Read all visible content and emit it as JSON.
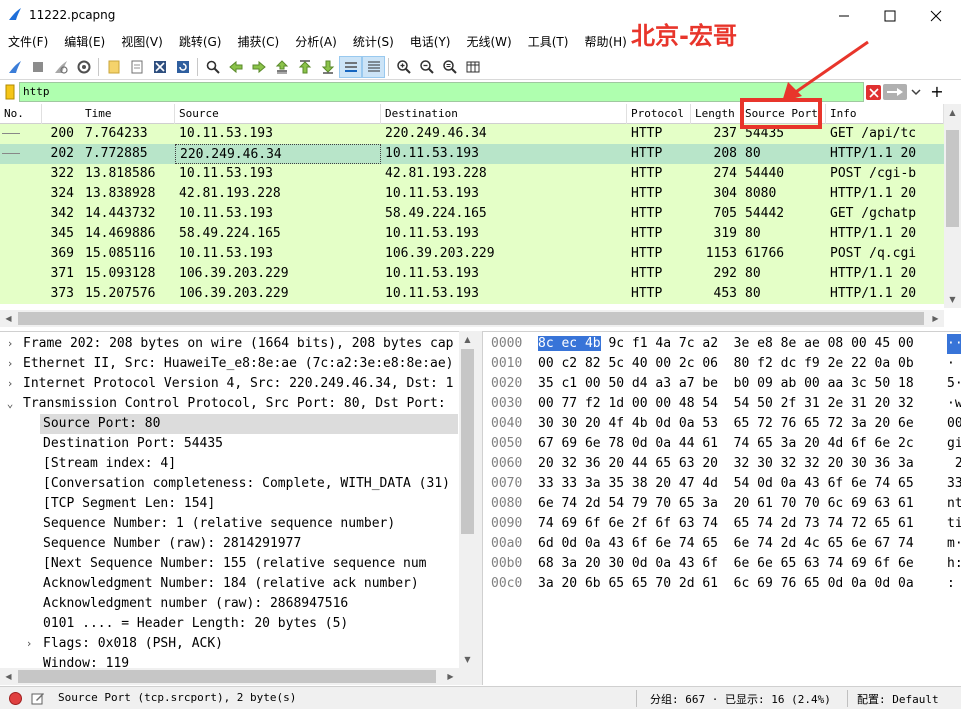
{
  "window": {
    "title": "11222.pcapng"
  },
  "annotation": {
    "text": "北京-宏哥"
  },
  "menu": [
    "文件(F)",
    "编辑(E)",
    "视图(V)",
    "跳转(G)",
    "捕获(C)",
    "分析(A)",
    "统计(S)",
    "电话(Y)",
    "无线(W)",
    "工具(T)",
    "帮助(H)"
  ],
  "filter": {
    "value": "http"
  },
  "packet_list": {
    "columns": [
      "No.",
      "Time",
      "Source",
      "Destination",
      "Protocol",
      "Length",
      "Source Port",
      "Info"
    ],
    "rows": [
      {
        "no": "200",
        "time": "7.764233",
        "src": "10.11.53.193",
        "dst": "220.249.46.34",
        "proto": "HTTP",
        "len": "237",
        "sport": "54435",
        "info": "GET /api/tc"
      },
      {
        "no": "202",
        "time": "7.772885",
        "src": "220.249.46.34",
        "dst": "10.11.53.193",
        "proto": "HTTP",
        "len": "208",
        "sport": "80",
        "info": "HTTP/1.1 20"
      },
      {
        "no": "322",
        "time": "13.818586",
        "src": "10.11.53.193",
        "dst": "42.81.193.228",
        "proto": "HTTP",
        "len": "274",
        "sport": "54440",
        "info": "POST /cgi-b"
      },
      {
        "no": "324",
        "time": "13.838928",
        "src": "42.81.193.228",
        "dst": "10.11.53.193",
        "proto": "HTTP",
        "len": "304",
        "sport": "8080",
        "info": "HTTP/1.1 20"
      },
      {
        "no": "342",
        "time": "14.443732",
        "src": "10.11.53.193",
        "dst": "58.49.224.165",
        "proto": "HTTP",
        "len": "705",
        "sport": "54442",
        "info": "GET /gchatp"
      },
      {
        "no": "345",
        "time": "14.469886",
        "src": "58.49.224.165",
        "dst": "10.11.53.193",
        "proto": "HTTP",
        "len": "319",
        "sport": "80",
        "info": "HTTP/1.1 20"
      },
      {
        "no": "369",
        "time": "15.085116",
        "src": "10.11.53.193",
        "dst": "106.39.203.229",
        "proto": "HTTP",
        "len": "1153",
        "sport": "61766",
        "info": "POST /q.cgi"
      },
      {
        "no": "371",
        "time": "15.093128",
        "src": "106.39.203.229",
        "dst": "10.11.53.193",
        "proto": "HTTP",
        "len": "292",
        "sport": "80",
        "info": "HTTP/1.1 20"
      },
      {
        "no": "373",
        "time": "15.207576",
        "src": "106.39.203.229",
        "dst": "10.11.53.193",
        "proto": "HTTP",
        "len": "453",
        "sport": "80",
        "info": "HTTP/1.1 20"
      }
    ]
  },
  "details": [
    {
      "expand": "closed",
      "text": "Frame 202: 208 bytes on wire (1664 bits), 208 bytes cap"
    },
    {
      "expand": "closed",
      "text": "Ethernet II, Src: HuaweiTe_e8:8e:ae (7c:a2:3e:e8:8e:ae)"
    },
    {
      "expand": "closed",
      "text": "Internet Protocol Version 4, Src: 220.249.46.34, Dst: 1"
    },
    {
      "expand": "open",
      "text": "Transmission Control Protocol, Src Port: 80, Dst Port:"
    },
    {
      "expand": "none",
      "text": "Source Port: 80"
    },
    {
      "expand": "none",
      "text": "Destination Port: 54435"
    },
    {
      "expand": "none",
      "text": "[Stream index: 4]"
    },
    {
      "expand": "none",
      "text": "[Conversation completeness: Complete, WITH_DATA (31)"
    },
    {
      "expand": "none",
      "text": "[TCP Segment Len: 154]"
    },
    {
      "expand": "none",
      "text": "Sequence Number: 1    (relative sequence number)"
    },
    {
      "expand": "none",
      "text": "Sequence Number (raw): 2814291977"
    },
    {
      "expand": "none",
      "text": "[Next Sequence Number: 155    (relative sequence num"
    },
    {
      "expand": "none",
      "text": "Acknowledgment Number: 184    (relative ack number)"
    },
    {
      "expand": "none",
      "text": "Acknowledgment number (raw): 2868947516"
    },
    {
      "expand": "none",
      "text": "0101 .... = Header Length: 20 bytes (5)"
    },
    {
      "expand": "closed",
      "text": "Flags: 0x018 (PSH, ACK)"
    },
    {
      "expand": "none",
      "text": "Window: 119"
    }
  ],
  "hex": {
    "rows": [
      {
        "offset": "0000",
        "hl": "8c ec 4b",
        "bytes": " 9c f1 4a 7c a2  3e e8 8e ae 08 00 45 00",
        "ascii": "··"
      },
      {
        "offset": "0010",
        "hl": "",
        "bytes": "00 c2 82 5c 40 00 2c 06  80 f2 dc f9 2e 22 0a 0b",
        "ascii": "·"
      },
      {
        "offset": "0020",
        "hl": "",
        "bytes": "35 c1 00 50 d4 a3 a7 be  b0 09 ab 00 aa 3c 50 18",
        "ascii": "5·"
      },
      {
        "offset": "0030",
        "hl": "",
        "bytes": "00 77 f2 1d 00 00 48 54  54 50 2f 31 2e 31 20 32",
        "ascii": "·w"
      },
      {
        "offset": "0040",
        "hl": "",
        "bytes": "30 30 20 4f 4b 0d 0a 53  65 72 76 65 72 3a 20 6e",
        "ascii": "00"
      },
      {
        "offset": "0050",
        "hl": "",
        "bytes": "67 69 6e 78 0d 0a 44 61  74 65 3a 20 4d 6f 6e 2c",
        "ascii": "gi"
      },
      {
        "offset": "0060",
        "hl": "",
        "bytes": "20 32 36 20 44 65 63 20  32 30 32 32 20 30 36 3a",
        "ascii": " 2"
      },
      {
        "offset": "0070",
        "hl": "",
        "bytes": "33 33 3a 35 38 20 47 4d  54 0d 0a 43 6f 6e 74 65",
        "ascii": "33"
      },
      {
        "offset": "0080",
        "hl": "",
        "bytes": "6e 74 2d 54 79 70 65 3a  20 61 70 70 6c 69 63 61",
        "ascii": "nt"
      },
      {
        "offset": "0090",
        "hl": "",
        "bytes": "74 69 6f 6e 2f 6f 63 74  65 74 2d 73 74 72 65 61",
        "ascii": "ti"
      },
      {
        "offset": "00a0",
        "hl": "",
        "bytes": "6d 0d 0a 43 6f 6e 74 65  6e 74 2d 4c 65 6e 67 74",
        "ascii": "m·"
      },
      {
        "offset": "00b0",
        "hl": "",
        "bytes": "68 3a 20 30 0d 0a 43 6f  6e 6e 65 63 74 69 6f 6e",
        "ascii": "h:"
      },
      {
        "offset": "00c0",
        "hl": "",
        "bytes": "3a 20 6b 65 65 70 2d 61  6c 69 76 65 0d 0a 0d 0a",
        "ascii": ":"
      }
    ]
  },
  "status": {
    "field": "Source Port (tcp.srcport), 2 byte(s)",
    "stats": "分组: 667 · 已显示: 16 (2.4%)",
    "profile": "配置: Default"
  },
  "colors": {
    "row_bg": "#e4ffc7",
    "row_selected": "#b8e5c9",
    "filter_bg": "#afffaf",
    "annotation": "#e8352b",
    "hex_highlight": "#3874d8"
  }
}
